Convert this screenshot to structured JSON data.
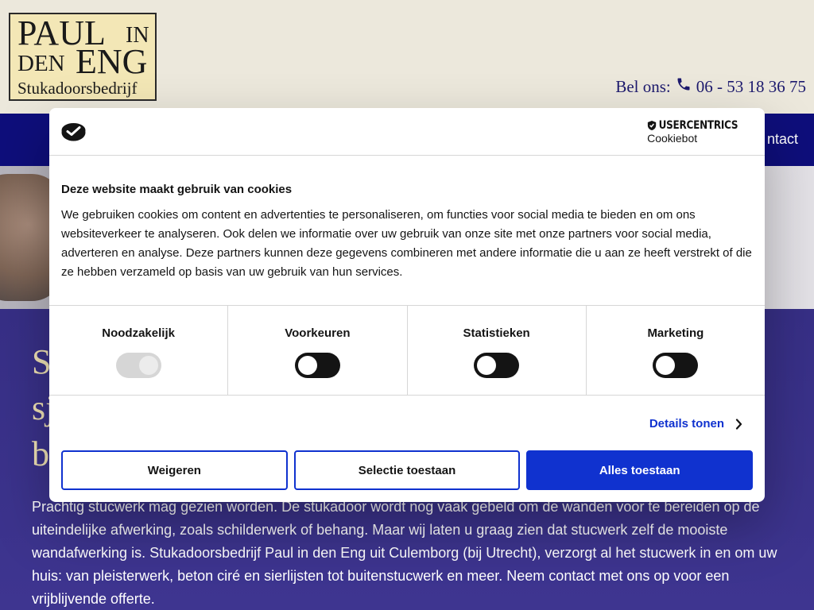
{
  "logo": {
    "line1": "PAUL",
    "line1_small": "IN",
    "line2_small": "DEN",
    "line2": "ENG",
    "line3": "Stukadoorsbedrijf"
  },
  "header": {
    "phone_label": "Bel ons:",
    "phone_number": "06 - 53 18 36 75",
    "phone_icon": "phone-icon"
  },
  "nav": {
    "contact_label": "ntact"
  },
  "content": {
    "heading_fragment": "S\nsj\nb",
    "body": "Prachtig stucwerk mag gezien worden. De stukadoor wordt nog vaak gebeld om de wanden voor te bereiden op de uiteindelijke afwerking, zoals schilderwerk of behang. Maar wij laten u graag zien dat stucwerk zelf de mooiste wandafwerking is. Stukadoorsbedrijf Paul in den Eng uit Culemborg (bij Utrecht), verzorgt al het stucwerk in en om uw huis: van pleisterwerk, beton ciré en sierlijsten tot buitenstucwerk en meer. Neem contact met ons op voor een vrijblijvende offerte."
  },
  "cookie_dialog": {
    "brand_name": "USERCENTRICS",
    "brand_sub": "Cookiebot",
    "title": "Deze website maakt gebruik van cookies",
    "text": "We gebruiken cookies om content en advertenties te personaliseren, om functies voor social media te bieden en om ons websiteverkeer te analyseren. Ook delen we informatie over uw gebruik van onze site met onze partners voor social media, adverteren en analyse. Deze partners kunnen deze gegevens combineren met andere informatie die u aan ze heeft verstrekt of die ze hebben verzameld op basis van uw gebruik van hun services.",
    "categories": [
      {
        "label": "Noodzakelijk",
        "enabled": true,
        "locked": true
      },
      {
        "label": "Voorkeuren",
        "enabled": false,
        "locked": false
      },
      {
        "label": "Statistieken",
        "enabled": false,
        "locked": false
      },
      {
        "label": "Marketing",
        "enabled": false,
        "locked": false
      }
    ],
    "details_label": "Details tonen",
    "buttons": {
      "reject": "Weigeren",
      "allow_selection": "Selectie toestaan",
      "allow_all": "Alles toestaan"
    }
  },
  "colors": {
    "header_bg": "#ece8dc",
    "nav_bg": "#0e0e7b",
    "content_bg": "#3d3585",
    "heading_color": "#f1e3b5",
    "accent_blue": "#1032cf"
  }
}
